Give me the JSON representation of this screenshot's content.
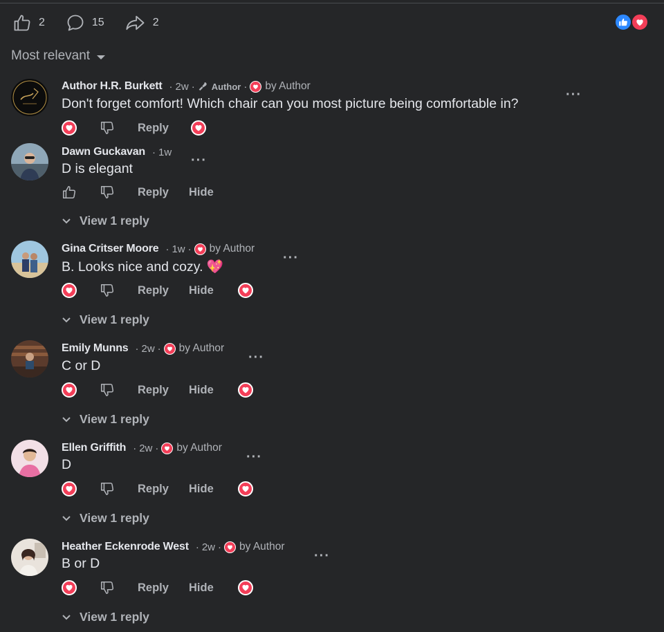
{
  "stats": {
    "likes": "2",
    "comments": "15",
    "shares": "2",
    "like_icon": "thumbs-up-icon",
    "comment_icon": "speech-bubble-icon",
    "share_icon": "share-arrow-icon"
  },
  "sort": {
    "label": "Most relevant"
  },
  "labels": {
    "reply": "Reply",
    "hide": "Hide",
    "by_author": "by Author",
    "author_badge": "Author",
    "view_reply": "View 1 reply",
    "separator": "·",
    "more": "···"
  },
  "colors": {
    "love": "#f33e58",
    "like": "#2d88ff",
    "background": "#252628"
  },
  "comments": [
    {
      "name": "Author H.R. Burkett",
      "time": "2w",
      "is_author": true,
      "loved": true,
      "text": "Don't forget comfort! Which chair can you most picture being comfortable in?",
      "reacted": "love",
      "hide": false,
      "view_reply": false
    },
    {
      "name": "Dawn Guckavan",
      "time": "1w",
      "is_author": false,
      "loved": false,
      "text": "D is elegant",
      "reacted": "like",
      "hide": true,
      "view_reply": true
    },
    {
      "name": "Gina Critser Moore",
      "time": "1w",
      "is_author": false,
      "loved": true,
      "text": "B. Looks nice and cozy. 💖",
      "reacted": "love",
      "hide": true,
      "view_reply": true
    },
    {
      "name": "Emily Munns",
      "time": "2w",
      "is_author": false,
      "loved": true,
      "text": "C or D",
      "reacted": "love",
      "hide": true,
      "view_reply": true
    },
    {
      "name": "Ellen Griffith",
      "time": "2w",
      "is_author": false,
      "loved": true,
      "text": "D",
      "reacted": "love",
      "hide": true,
      "view_reply": true
    },
    {
      "name": "Heather Eckenrode West",
      "time": "2w",
      "is_author": false,
      "loved": true,
      "text": "B or D",
      "reacted": "love",
      "hide": true,
      "view_reply": true
    }
  ]
}
